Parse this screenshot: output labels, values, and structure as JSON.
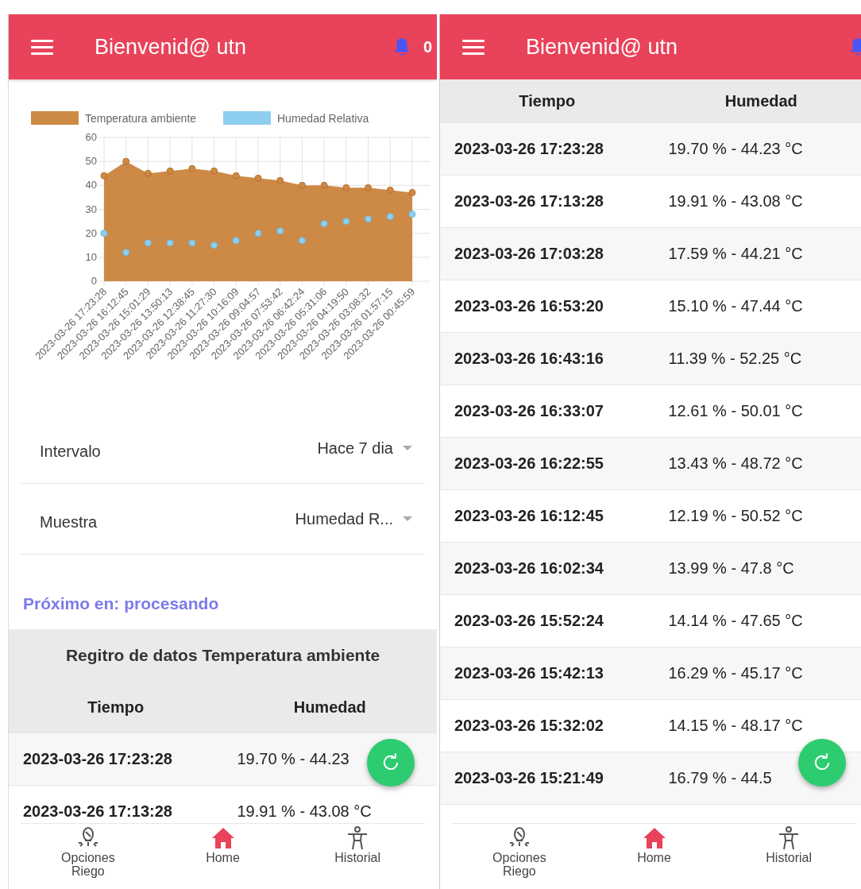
{
  "panels": [
    {
      "header": {
        "title": "Bienvenid@ utn",
        "notifications": "0"
      },
      "chart": {
        "chart_data": {
          "type": "area",
          "categories": [
            "2023-03-26 17:23:28",
            "2023-03-26 16:12:45",
            "2023-03-26 15:01:29",
            "2023-03-26 13:50:13",
            "2023-03-26 12:38:45",
            "2023-03-26 11:27:30",
            "2023-03-26 10:16:09",
            "2023-03-26 09:04:57",
            "2023-03-26 07:53:42",
            "2023-03-26 06:42:24",
            "2023-03-26 05:31:06",
            "2023-03-26 04:19:50",
            "2023-03-26 03:08:32",
            "2023-03-26 01:57:15",
            "2023-03-26 00:45:59"
          ],
          "series": [
            {
              "name": "Temperatura ambiente",
              "color": "#cd8a46",
              "values": [
                44,
                50,
                45,
                46,
                47,
                46,
                44,
                43,
                42,
                40,
                40,
                39,
                39,
                38,
                37
              ]
            },
            {
              "name": "Humedad Relativa",
              "color": "#8ecfef",
              "type": "scatter",
              "values": [
                20,
                12,
                16,
                16,
                16,
                15,
                17,
                20,
                21,
                17,
                24,
                25,
                26,
                27,
                28
              ]
            }
          ],
          "grid": true,
          "legend": "top",
          "ylim": [
            0,
            60
          ],
          "yticks": [
            0,
            10,
            20,
            30,
            40,
            50,
            60
          ]
        }
      },
      "selects": [
        {
          "label": "Intervalo",
          "value": "Hace 7 dia"
        },
        {
          "label": "Muestra",
          "value": "Humedad R..."
        }
      ],
      "next_text": "Próximo en: procesando",
      "table": {
        "title": "Regitro de datos Temperatura ambiente",
        "columns": [
          "Tiempo",
          "Humedad"
        ],
        "rows": [
          [
            "2023-03-26 17:23:28",
            "19.70 % - 44.23"
          ],
          [
            "2023-03-26 17:13:28",
            "19.91 % - 43.08 °C"
          ]
        ]
      },
      "nav": [
        {
          "label": "Opciones Riego",
          "kind": "sprinkler",
          "selected": false
        },
        {
          "label": "Home",
          "kind": "home",
          "selected": true
        },
        {
          "label": "Historial",
          "kind": "person",
          "selected": false
        }
      ]
    },
    {
      "header": {
        "title": "Bienvenid@ utn"
      },
      "table": {
        "columns": [
          "Tiempo",
          "Humedad"
        ],
        "rows": [
          [
            "2023-03-26 17:23:28",
            "19.70 % - 44.23 °C"
          ],
          [
            "2023-03-26 17:13:28",
            "19.91 % - 43.08 °C"
          ],
          [
            "2023-03-26 17:03:28",
            "17.59 % - 44.21 °C"
          ],
          [
            "2023-03-26 16:53:20",
            "15.10 % - 47.44 °C"
          ],
          [
            "2023-03-26 16:43:16",
            "11.39 % - 52.25 °C"
          ],
          [
            "2023-03-26 16:33:07",
            "12.61 % - 50.01 °C"
          ],
          [
            "2023-03-26 16:22:55",
            "13.43 % - 48.72 °C"
          ],
          [
            "2023-03-26 16:12:45",
            "12.19 % - 50.52 °C"
          ],
          [
            "2023-03-26 16:02:34",
            "13.99 % - 47.8 °C"
          ],
          [
            "2023-03-26 15:52:24",
            "14.14 % - 47.65 °C"
          ],
          [
            "2023-03-26 15:42:13",
            "16.29 % - 45.17 °C"
          ],
          [
            "2023-03-26 15:32:02",
            "14.15 % - 48.17 °C"
          ],
          [
            "2023-03-26 15:21:49",
            "16.79 % - 44.5"
          ]
        ]
      },
      "nav": [
        {
          "label": "Opciones Riego",
          "kind": "sprinkler",
          "selected": false
        },
        {
          "label": "Home",
          "kind": "home",
          "selected": true
        },
        {
          "label": "Historial",
          "kind": "person",
          "selected": false
        }
      ]
    }
  ]
}
